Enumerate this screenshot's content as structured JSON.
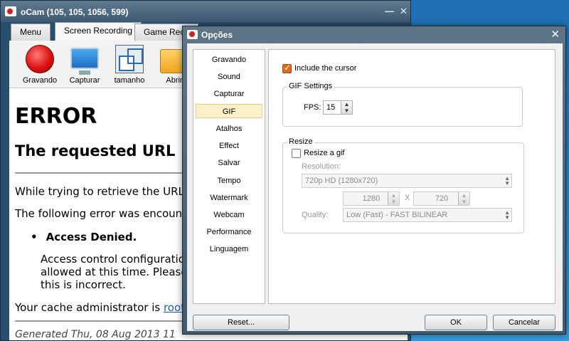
{
  "ocam": {
    "title": "oCam (105, 105, 1056, 599)",
    "minimize": "—",
    "close": "✕",
    "tabs": [
      "Menu",
      "Screen Recording",
      "Game Reco"
    ],
    "toolbar": [
      "Gravando",
      "Capturar",
      "tamanho",
      "Abrir"
    ]
  },
  "page": {
    "h1": "ERROR",
    "h2": "The requested URL",
    "p1": "While trying to retrieve the URL:",
    "p2": "The following error was encounte",
    "bullet": "Access Denied.",
    "ind1": "Access control configuration",
    "ind2": "allowed at this time. Please",
    "ind3": "this is incorrect.",
    "admin_prefix": "Your cache administrator is ",
    "admin_link": "root",
    "admin_suffix": ".",
    "footer": "Generated Thu, 08 Aug 2013 11"
  },
  "dialog": {
    "title": "Opções",
    "close": "✕",
    "sidebar": [
      "Gravando",
      "Sound",
      "Capturar",
      "GIF",
      "Atalhos",
      "Effect",
      "Salvar",
      "Tempo",
      "Watermark",
      "Webcam",
      "Performance",
      "Linguagem"
    ],
    "selected": "GIF",
    "include_cursor": "Include the cursor",
    "gif_settings": "GIF Settings",
    "fps_label": "FPS:",
    "fps_value": "15",
    "resize_group": "Resize",
    "resize_label": "Resize a gif",
    "resolution_label": "Resolution:",
    "resolution_value": "720p HD (1280x720)",
    "width": "1280",
    "x_sep": "X",
    "height": "720",
    "quality_label": "Quality:",
    "quality_value": "Low (Fast) - FAST BILINEAR",
    "reset": "Reset...",
    "ok": "OK",
    "cancel": "Cancelar"
  }
}
